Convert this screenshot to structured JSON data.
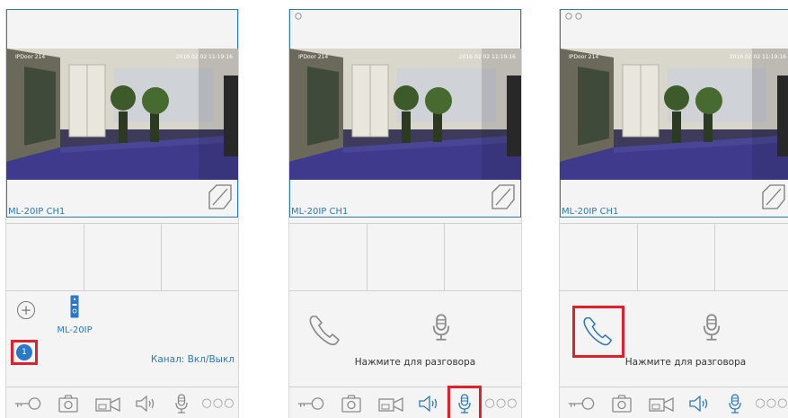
{
  "video": {
    "channel_label": "ML-20IP CH1",
    "overlay_left": "IPDoor 214",
    "overlay_right": "2016 02 02 11:19:16"
  },
  "panel1": {
    "add_device": "+",
    "device_name": "ML-20IP",
    "badge": "1",
    "channel_toggle": "Канал: Вкл/Выкл"
  },
  "talk": {
    "hint": "Нажмите для разговора"
  },
  "toolbar": {
    "more": "○○○"
  },
  "colors": {
    "accent": "#2a78c6",
    "highlight": "#e0202a"
  }
}
